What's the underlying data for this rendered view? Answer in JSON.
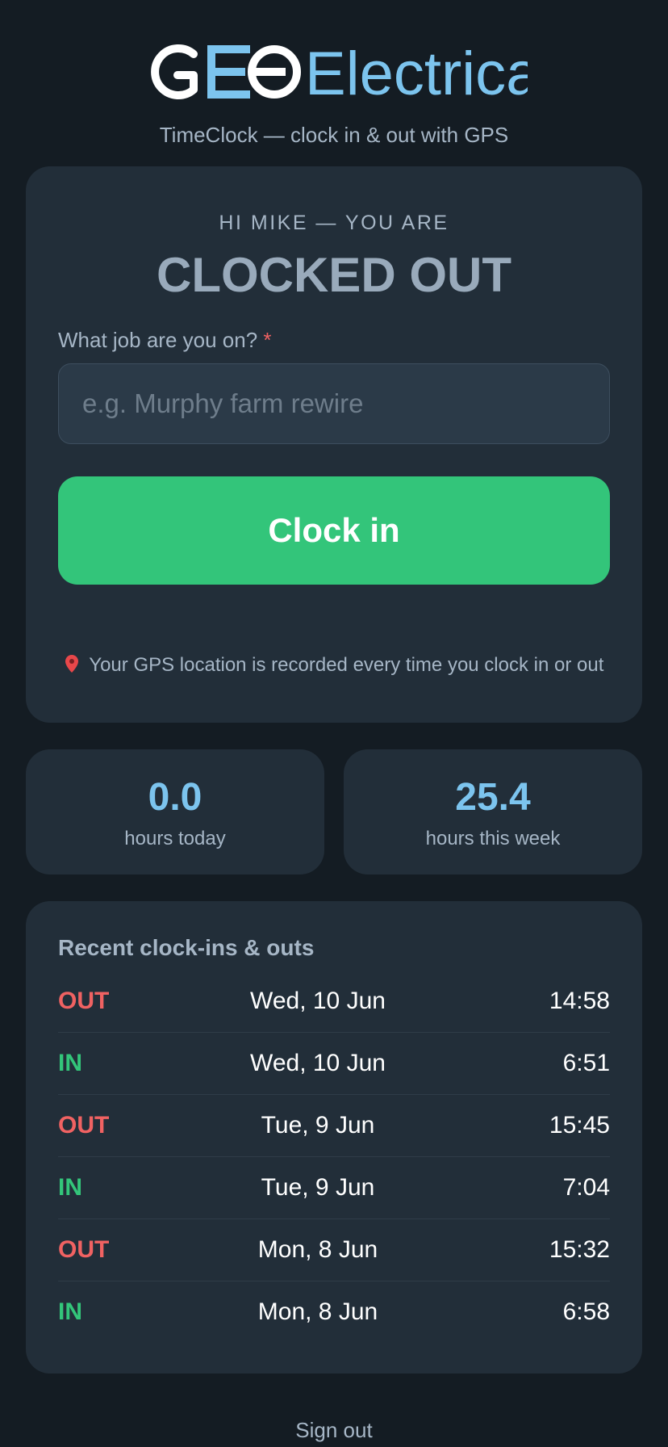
{
  "app": {
    "brand_logo": "GEO",
    "brand_name": "Electrical",
    "subtitle": "TimeClock — clock in & out with GPS"
  },
  "status": {
    "greeting": "HI MIKE — YOU ARE",
    "state": "CLOCKED OUT"
  },
  "job": {
    "label": "What job are you on?",
    "required_mark": "*",
    "placeholder": "e.g. Murphy farm rewire",
    "value": ""
  },
  "clock_button": {
    "label": "Clock in"
  },
  "gps_note": {
    "icon": "pin-icon",
    "text": "Your GPS location is recorded every time you clock in or out"
  },
  "stats": [
    {
      "value": "0.0",
      "label": "hours today"
    },
    {
      "value": "25.4",
      "label": "hours this week"
    }
  ],
  "recent": {
    "title": "Recent clock-ins & outs",
    "rows": [
      {
        "type": "OUT",
        "date": "Wed, 10 Jun",
        "time": "14:58"
      },
      {
        "type": "IN",
        "date": "Wed, 10 Jun",
        "time": "6:51"
      },
      {
        "type": "OUT",
        "date": "Tue, 9 Jun",
        "time": "15:45"
      },
      {
        "type": "IN",
        "date": "Tue, 9 Jun",
        "time": "7:04"
      },
      {
        "type": "OUT",
        "date": "Mon, 8 Jun",
        "time": "15:32"
      },
      {
        "type": "IN",
        "date": "Mon, 8 Jun",
        "time": "6:58"
      }
    ]
  },
  "signout": {
    "label": "Sign out"
  },
  "colors": {
    "background": "#141c23",
    "card": "#222e39",
    "accent_blue": "#7cc4ee",
    "clock_in_green": "#33c57a",
    "out_red": "#f06262",
    "muted_text": "#a6b6c6"
  }
}
